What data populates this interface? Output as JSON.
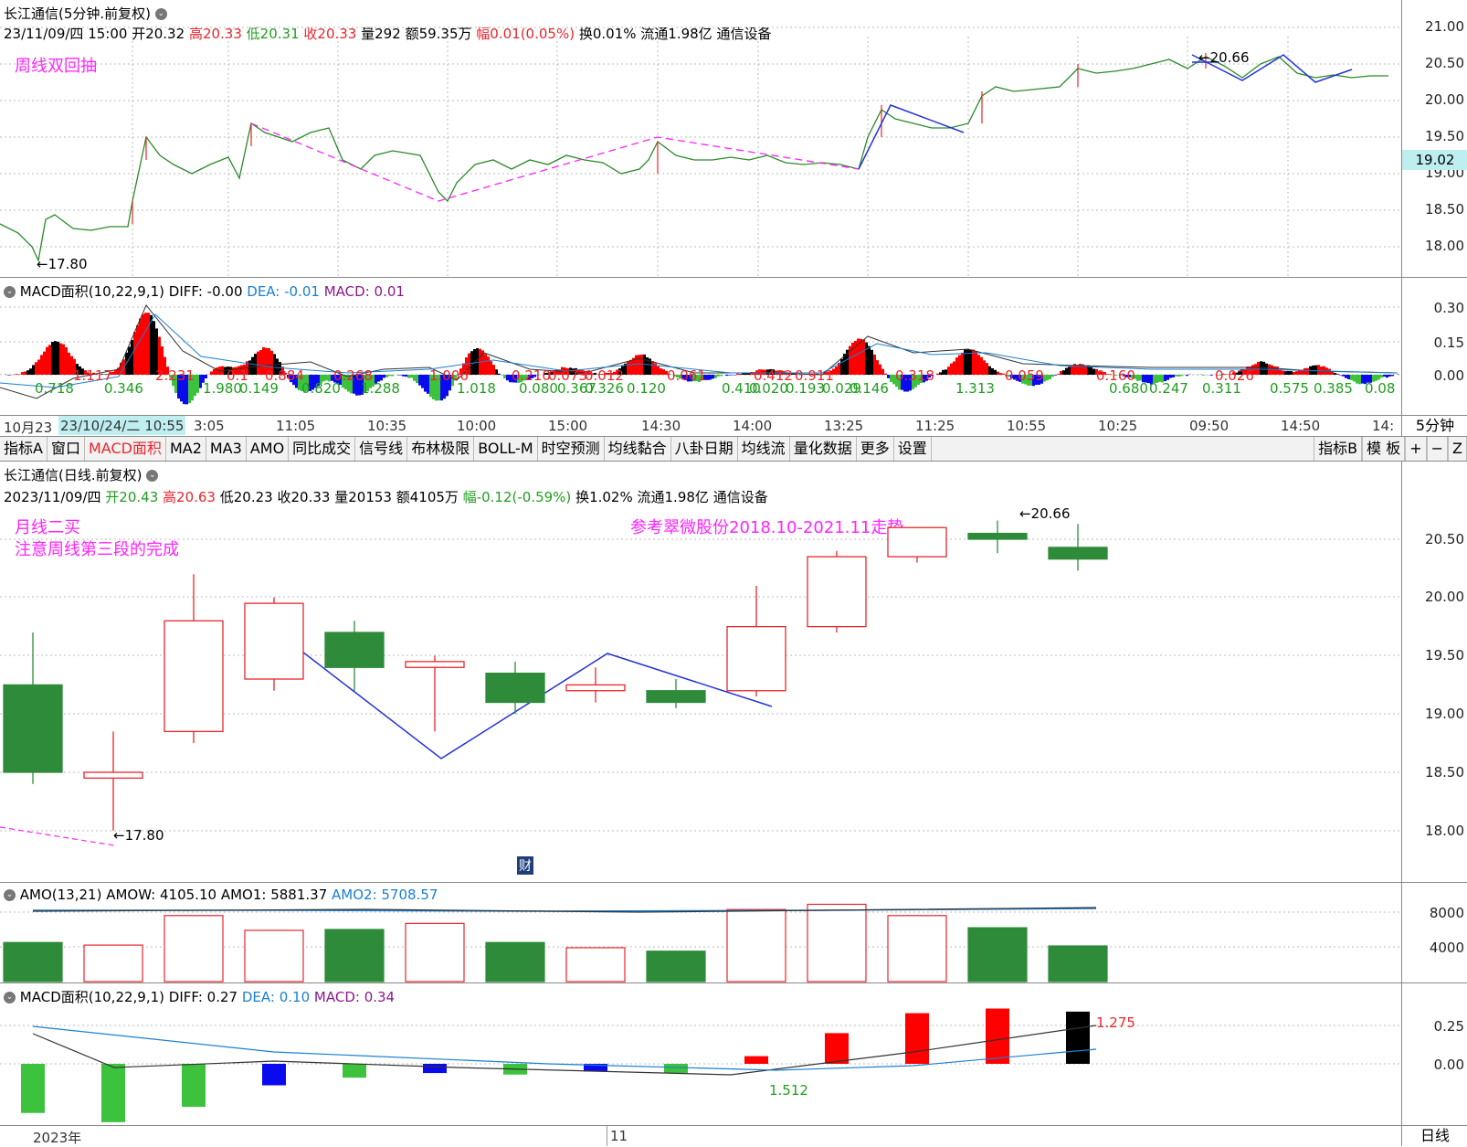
{
  "top": {
    "title": "长江通信(5分钟.前复权)",
    "info_date": "23/11/09/四 15:00",
    "open": "开20.32",
    "high": "高20.33",
    "low": "低20.31",
    "close": "收20.33",
    "vol": "量292",
    "amount": "额59.35万",
    "change": "幅0.01(0.05%)",
    "turnover": "换0.01%",
    "float": "流通1.98亿",
    "sector": "通信设备",
    "note": "周线双回抽",
    "low_label": "←17.80",
    "high_label": "←20.66",
    "price_flag": "19.02",
    "y_ticks": [
      "21.00",
      "20.50",
      "20.00",
      "19.50",
      "19.00",
      "18.50",
      "18.00"
    ]
  },
  "macd5": {
    "title": "MACD面积(10,22,9,1)",
    "diff": "DIFF: -0.00",
    "dea": "DEA: -0.01",
    "macd": "MACD: 0.01",
    "y_ticks": [
      "0.30",
      "0.15",
      "0.00"
    ],
    "area_labels_red": [
      "1.117",
      "2.231",
      "0.1",
      "0.884",
      "0.268",
      "1.006",
      "0.210",
      "0.073",
      "0.012",
      "0.061",
      "0.412",
      "0.911",
      "0.318",
      "0.059",
      "0.160",
      "0.026"
    ],
    "area_labels_green": [
      "0.718",
      "0.346",
      "1.980",
      "0.149",
      "0.820",
      "1.288",
      "1.018",
      "0.080",
      "0.367",
      "0.326",
      "0.120",
      "0.410",
      "0.020",
      "0.193",
      "0.029",
      "0.146",
      "1.313",
      "0.680",
      "0.247",
      "0.311",
      "0.575",
      "0.385",
      "0.08"
    ]
  },
  "xaxis5": {
    "labels": [
      "10月23",
      "23/10/24/二 10:55",
      "3:05",
      "11:05",
      "10:35",
      "10:00",
      "15:00",
      "14:30",
      "14:00",
      "13:25",
      "11:25",
      "10:55",
      "10:25",
      "09:50",
      "14:50",
      "14:"
    ],
    "period": "5分钟"
  },
  "toolbar": {
    "items": [
      "指标A",
      "窗口",
      "MACD面积",
      "MA2",
      "MA3",
      "AMO",
      "同比成交",
      "信号线",
      "布林极限",
      "BOLL-M",
      "时空预测",
      "均线黏合",
      "八卦日期",
      "均线流",
      "量化数据",
      "更多",
      "设置"
    ],
    "right_items": [
      "指标B",
      "模 板",
      "+",
      "−",
      "Z"
    ]
  },
  "daily": {
    "title": "长江通信(日线.前复权)",
    "info_date": "2023/11/09/四",
    "open": "开20.43",
    "high": "高20.63",
    "low": "低20.23",
    "close": "收20.33",
    "vol": "量20153",
    "amount": "额4105万",
    "change": "幅-0.12(-0.59%)",
    "turnover": "换1.02%",
    "float": "流通1.98亿",
    "sector": "通信设备",
    "note1": "月线二买",
    "note2": "注意周线第三段的完成",
    "note3": "参考翠微股份2018.10-2021.11走势",
    "low_label": "←17.80",
    "high_label": "←20.66",
    "cai": "财",
    "y_ticks": [
      "20.50",
      "20.00",
      "19.50",
      "19.00",
      "18.50",
      "18.00"
    ],
    "candles": [
      {
        "o": 19.25,
        "c": 18.5,
        "h": 19.7,
        "l": 18.4
      },
      {
        "o": 18.45,
        "c": 18.5,
        "h": 18.85,
        "l": 18.0
      },
      {
        "o": 18.85,
        "c": 19.8,
        "h": 20.2,
        "l": 18.75
      },
      {
        "o": 19.3,
        "c": 19.95,
        "h": 20.0,
        "l": 19.2
      },
      {
        "o": 19.7,
        "c": 19.4,
        "h": 19.8,
        "l": 19.2
      },
      {
        "o": 19.4,
        "c": 19.45,
        "h": 19.5,
        "l": 18.85
      },
      {
        "o": 19.35,
        "c": 19.1,
        "h": 19.45,
        "l": 19.0
      },
      {
        "o": 19.2,
        "c": 19.25,
        "h": 19.4,
        "l": 19.1
      },
      {
        "o": 19.2,
        "c": 19.1,
        "h": 19.3,
        "l": 19.05
      },
      {
        "o": 19.2,
        "c": 19.75,
        "h": 20.1,
        "l": 19.15
      },
      {
        "o": 19.75,
        "c": 20.35,
        "h": 20.4,
        "l": 19.7
      },
      {
        "o": 20.35,
        "c": 20.6,
        "h": 20.6,
        "l": 20.3
      },
      {
        "o": 20.55,
        "c": 20.5,
        "h": 20.66,
        "l": 20.38
      },
      {
        "o": 20.43,
        "c": 20.33,
        "h": 20.63,
        "l": 20.23
      }
    ]
  },
  "amo": {
    "title": "AMO(13,21)",
    "amow": "AMOW: 4105.10",
    "amo1": "AMO1: 5881.37",
    "amo2": "AMO2: 5708.57",
    "y_ticks": [
      "8000",
      "4000"
    ],
    "values": [
      4500,
      4200,
      7600,
      5900,
      6000,
      6700,
      4500,
      3900,
      3500,
      8300,
      8900,
      7600,
      6200,
      4105
    ]
  },
  "macdd": {
    "title": "MACD面积(10,22,9,1)",
    "diff": "DIFF: 0.27",
    "dea": "DEA: 0.10",
    "macd": "MACD: 0.34",
    "y_ticks": [
      "0.25",
      "0.00"
    ],
    "values": [
      -0.32,
      -0.38,
      -0.28,
      -0.14,
      -0.09,
      -0.06,
      -0.07,
      -0.05,
      -0.06,
      0.05,
      0.2,
      0.33,
      0.36,
      0.34
    ],
    "label_green": "1.512",
    "label_red": "1.275"
  },
  "xaxisd": {
    "labels": [
      "2023年",
      "11"
    ],
    "period": "日线"
  }
}
